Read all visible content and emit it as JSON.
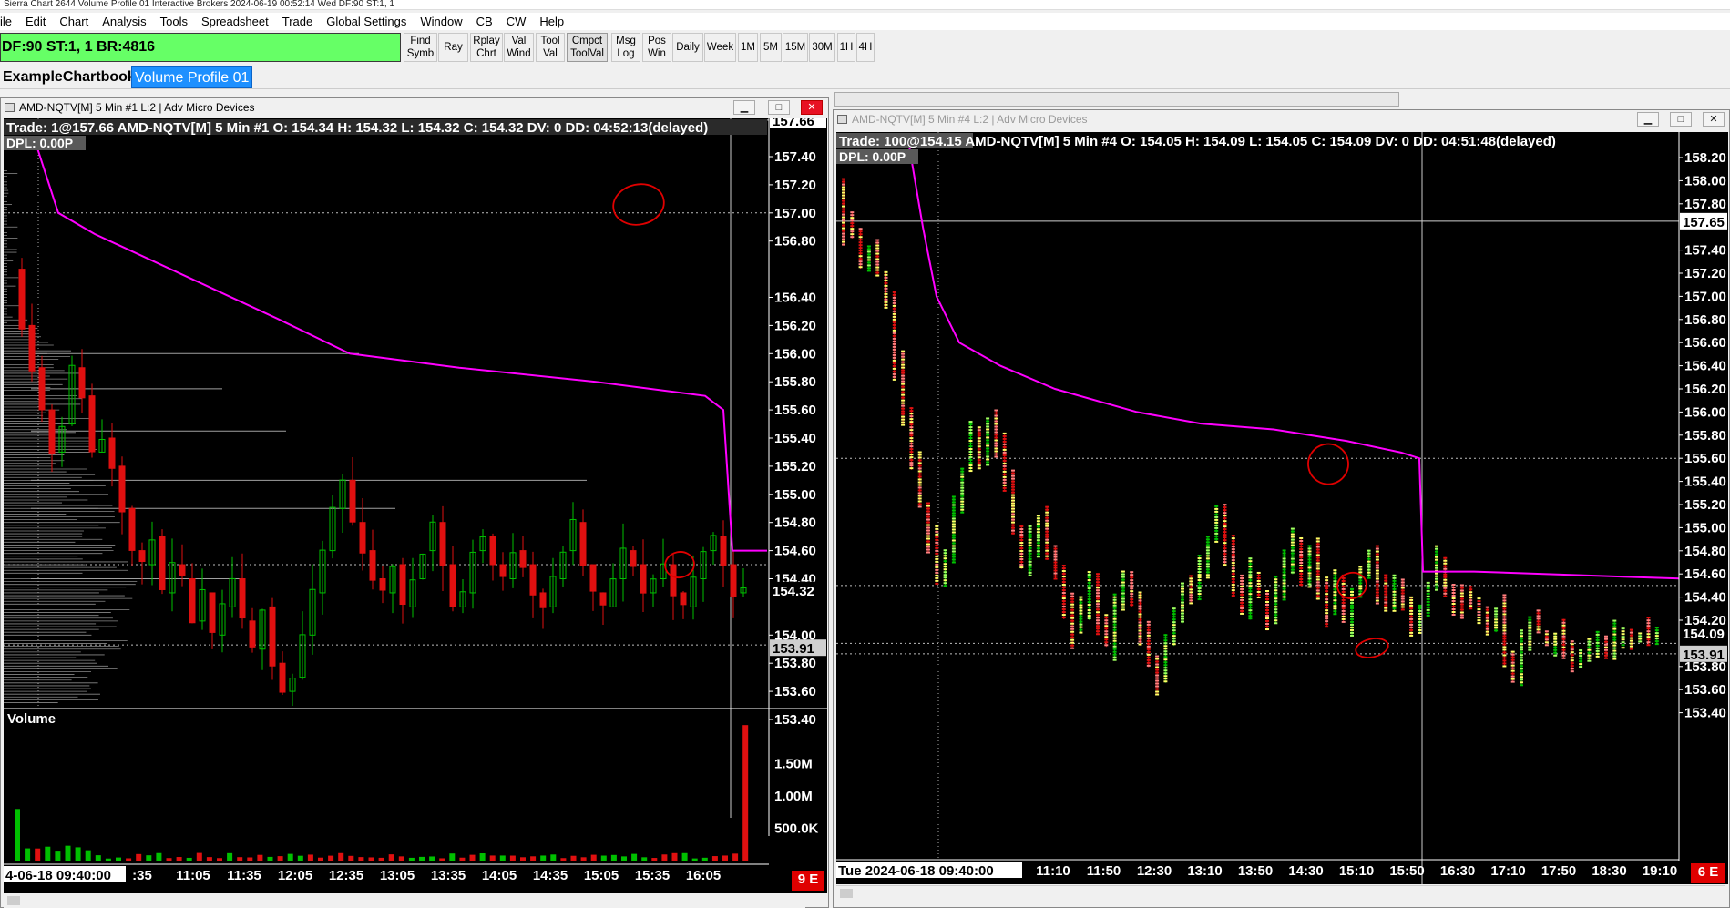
{
  "window_title": "Sierra Chart 2644 Volume Profile 01 Interactive Brokers 2024-06-19  00:52:14 Wed DF:90  ST:1, 1",
  "menu": [
    "ile",
    "Edit",
    "Chart",
    "Analysis",
    "Tools",
    "Spreadsheet",
    "Trade",
    "Global Settings",
    "Window",
    "CB",
    "CW",
    "Help"
  ],
  "status_text": "DF:90  ST:1, 1   BR:4816",
  "toolbar_buttons": [
    "Find\nSymb",
    "Ray",
    "Rplay\nChrt",
    "Val\nWind",
    "Tool\nVal",
    "Cmpct\nToolVal",
    "Msg\nLog",
    "Pos\nWin",
    "Daily",
    "Week",
    "1M",
    "5M",
    "15M",
    "30M",
    "1H",
    "4H"
  ],
  "chartbook_tabs": [
    "ExampleChartbook",
    "Volume Profile 01"
  ],
  "left_window": {
    "title": "AMD-NQTV[M]  5 Min  #1 L:2 | Adv Micro Devices",
    "header": "Trade: 1@157.66  AMD-NQTV[M]  5 Min  #1 O: 154.34 H: 154.32 L: 154.32 C: 154.32 DV: 0 DD: 04:52:13(delayed)",
    "dpl": "DPL: 0.00P",
    "price_labels": [
      "157.40",
      "157.20",
      "157.00",
      "156.80",
      "156.40",
      "156.20",
      "156.00",
      "155.80",
      "155.60",
      "155.40",
      "155.20",
      "155.00",
      "154.80",
      "154.60",
      "154.40",
      "154.00",
      "153.80",
      "153.60",
      "153.40"
    ],
    "price_values": [
      157.4,
      157.2,
      157.0,
      156.8,
      156.4,
      156.2,
      156.0,
      155.8,
      155.6,
      155.4,
      155.2,
      155.0,
      154.8,
      154.6,
      154.4,
      154.0,
      153.8,
      153.6,
      153.4
    ],
    "top_price": "157.66",
    "last_price": "154.32",
    "ref_price": "153.91",
    "volume_title": "Volume",
    "volume_labels": [
      "1.50M",
      "1.00M",
      "500.0K"
    ],
    "volume_values": [
      1500000,
      1000000,
      500000
    ],
    "time_start": "4-06-18  09:40:00",
    "time_labels": [
      ":35",
      "11:05",
      "11:35",
      "12:05",
      "12:35",
      "13:05",
      "13:35",
      "14:05",
      "14:35",
      "15:05",
      "15:35",
      "16:05"
    ],
    "badge": "9 E"
  },
  "right_window": {
    "title": "AMD-NQTV[M]  5 Min  #4 L:2 | Adv Micro Devices",
    "header": "Trade: 100@154.15  AMD-NQTV[M]  5 Min  #4 O: 154.05 H: 154.09 L: 154.05 C: 154.09 DV: 0 DD: 04:51:48(delayed)",
    "dpl": "DPL: 0.00P",
    "price_labels": [
      "158.20",
      "158.00",
      "157.80",
      "157.40",
      "157.20",
      "157.00",
      "156.80",
      "156.60",
      "156.40",
      "156.20",
      "156.00",
      "155.80",
      "155.60",
      "155.40",
      "155.20",
      "155.00",
      "154.80",
      "154.60",
      "154.40",
      "154.20",
      "153.80",
      "153.60",
      "153.40"
    ],
    "price_values": [
      158.2,
      158.0,
      157.8,
      157.4,
      157.2,
      157.0,
      156.8,
      156.6,
      156.4,
      156.2,
      156.0,
      155.8,
      155.6,
      155.4,
      155.2,
      155.0,
      154.8,
      154.6,
      154.4,
      154.2,
      153.8,
      153.6,
      153.4
    ],
    "top_price": "157.65",
    "last_price": "154.09",
    "ref_price": "153.91",
    "time_start": "Tue 2024-06-18  09:40:00",
    "time_labels": [
      "11:10",
      "11:50",
      "12:30",
      "13:10",
      "13:50",
      "14:30",
      "15:10",
      "15:50",
      "16:30",
      "17:10",
      "17:50",
      "18:30",
      "19:10"
    ],
    "badge": "6 E"
  },
  "colors": {
    "vwap": "#ff00ff",
    "up_bar": "#00c000",
    "down_bar": "#e01010",
    "profile": "#a0a0a0",
    "annotation": "#e00000",
    "status_green": "#66ff66",
    "tab_active": "#1e90ff"
  }
}
